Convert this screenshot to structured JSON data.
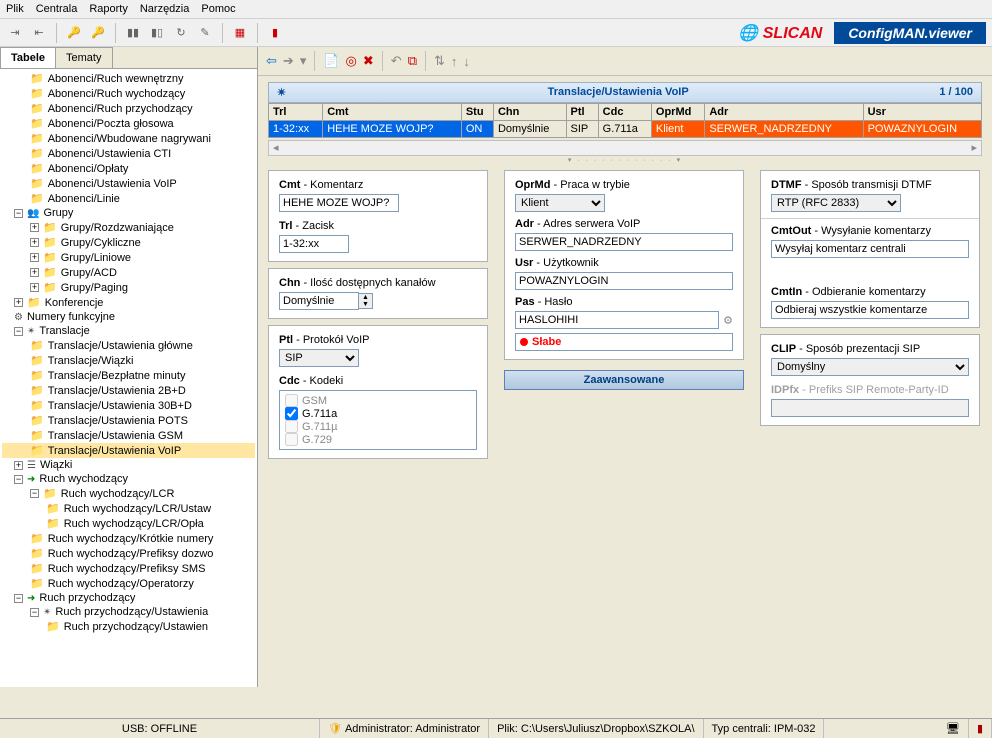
{
  "menu": [
    "Plik",
    "Centrala",
    "Raporty",
    "Narzędzia",
    "Pomoc"
  ],
  "brand": {
    "logo": "SLICAN",
    "title": "ConfigMAN.viewer"
  },
  "tabs": {
    "active": "Tabele",
    "other": "Tematy"
  },
  "tree": [
    {
      "lvl": 1,
      "icon": "f",
      "text": "Abonenci/Ruch wewnętrzny"
    },
    {
      "lvl": 1,
      "icon": "f",
      "text": "Abonenci/Ruch wychodzący"
    },
    {
      "lvl": 1,
      "icon": "f",
      "text": "Abonenci/Ruch przychodzący"
    },
    {
      "lvl": 1,
      "icon": "f",
      "text": "Abonenci/Poczta głosowa"
    },
    {
      "lvl": 1,
      "icon": "f",
      "text": "Abonenci/Wbudowane nagrywani"
    },
    {
      "lvl": 1,
      "icon": "f",
      "text": "Abonenci/Ustawienia CTI"
    },
    {
      "lvl": 1,
      "icon": "f",
      "text": "Abonenci/Opłaty"
    },
    {
      "lvl": 1,
      "icon": "f",
      "text": "Abonenci/Ustawienia VoIP"
    },
    {
      "lvl": 1,
      "icon": "f",
      "text": "Abonenci/Linie"
    },
    {
      "lvl": 0,
      "icon": "bm",
      "text": "Grupy"
    },
    {
      "lvl": 1,
      "icon": "bp",
      "text": "Grupy/Rozdzwaniające"
    },
    {
      "lvl": 1,
      "icon": "bp",
      "text": "Grupy/Cykliczne"
    },
    {
      "lvl": 1,
      "icon": "bp",
      "text": "Grupy/Liniowe"
    },
    {
      "lvl": 1,
      "icon": "bp",
      "text": "Grupy/ACD"
    },
    {
      "lvl": 1,
      "icon": "bp",
      "text": "Grupy/Paging"
    },
    {
      "lvl": 0,
      "icon": "bp",
      "text": "Konferencje"
    },
    {
      "lvl": 0,
      "icon": "m",
      "text": "Numery funkcyjne"
    },
    {
      "lvl": 0,
      "icon": "bm-t",
      "text": "Translacje"
    },
    {
      "lvl": 1,
      "icon": "f",
      "text": "Translacje/Ustawienia główne"
    },
    {
      "lvl": 1,
      "icon": "f",
      "text": "Translacje/Wiązki"
    },
    {
      "lvl": 1,
      "icon": "f",
      "text": "Translacje/Bezpłatne minuty"
    },
    {
      "lvl": 1,
      "icon": "f",
      "text": "Translacje/Ustawienia 2B+D"
    },
    {
      "lvl": 1,
      "icon": "f",
      "text": "Translacje/Ustawienia 30B+D"
    },
    {
      "lvl": 1,
      "icon": "f",
      "text": "Translacje/Ustawienia POTS"
    },
    {
      "lvl": 1,
      "icon": "f",
      "text": "Translacje/Ustawienia GSM"
    },
    {
      "lvl": 1,
      "icon": "f",
      "text": "Translacje/Ustawienia VoIP",
      "sel": true
    },
    {
      "lvl": 0,
      "icon": "bp-w",
      "text": "Wiązki"
    },
    {
      "lvl": 0,
      "icon": "bm-a",
      "text": "Ruch wychodzący"
    },
    {
      "lvl": 1,
      "icon": "bm-f",
      "text": "Ruch wychodzący/LCR"
    },
    {
      "lvl": 2,
      "icon": "f",
      "text": "Ruch wychodzący/LCR/Ustaw"
    },
    {
      "lvl": 2,
      "icon": "f",
      "text": "Ruch wychodzący/LCR/Opła"
    },
    {
      "lvl": 1,
      "icon": "f",
      "text": "Ruch wychodzący/Krótkie numery"
    },
    {
      "lvl": 1,
      "icon": "f",
      "text": "Ruch wychodzący/Prefiksy dozwo"
    },
    {
      "lvl": 1,
      "icon": "f",
      "text": "Ruch wychodzący/Prefiksy SMS"
    },
    {
      "lvl": 1,
      "icon": "f",
      "text": "Ruch wychodzący/Operatorzy"
    },
    {
      "lvl": 0,
      "icon": "bm-a",
      "text": "Ruch przychodzący"
    },
    {
      "lvl": 1,
      "icon": "bm-t",
      "text": "Ruch przychodzący/Ustawienia"
    },
    {
      "lvl": 2,
      "icon": "f",
      "text": "Ruch przychodzący/Ustawien"
    }
  ],
  "grid": {
    "title": "Translacje/Ustawienia VoIP",
    "counter": "1 / 100",
    "headers": [
      "Trl",
      "Cmt",
      "Stu",
      "Chn",
      "Ptl",
      "Cdc",
      "OprMd",
      "Adr",
      "Usr"
    ],
    "row": {
      "Trl": "1-32:xx",
      "Cmt": "HEHE MOZE WOJP?",
      "Stu": "ON",
      "Chn": "Domyślnie",
      "Ptl": "SIP",
      "Cdc": "G.711a",
      "OprMd": "Klient",
      "Adr": "SERWER_NADRZEDNY",
      "Usr": "POWAZNYLOGIN"
    }
  },
  "form": {
    "cmt": {
      "label_b": "Cmt",
      "label": " - Komentarz",
      "value": "HEHE MOZE WOJP?"
    },
    "trl": {
      "label_b": "Trl",
      "label": " - Zacisk",
      "value": "1-32:xx"
    },
    "chn": {
      "label_b": "Chn",
      "label": " - Ilość dostępnych kanałów",
      "value": "Domyślnie"
    },
    "ptl": {
      "label_b": "Ptl",
      "label": " - Protokół VoIP",
      "value": "SIP"
    },
    "cdc": {
      "label_b": "Cdc",
      "label": " - Kodeki",
      "items": [
        "GSM",
        "G.711a",
        "G.711µ",
        "G.729"
      ],
      "checked": 1
    },
    "oprmd": {
      "label_b": "OprMd",
      "label": " - Praca w trybie",
      "value": "Klient"
    },
    "adr": {
      "label_b": "Adr",
      "label": " - Adres serwera VoIP",
      "value": "SERWER_NADRZEDNY"
    },
    "usr": {
      "label_b": "Usr",
      "label": " - Użytkownik",
      "value": "POWAZNYLOGIN"
    },
    "pas": {
      "label_b": "Pas",
      "label": " - Hasło",
      "value": "HASLOHIHI"
    },
    "pas_strength": "Słabe",
    "advanced": "Zaawansowane",
    "dtmf": {
      "label_b": "DTMF",
      "label": " - Sposób transmisji DTMF",
      "value": "RTP (RFC 2833)"
    },
    "cmtout": {
      "label_b": "CmtOut",
      "label": " - Wysyłanie komentarzy",
      "value": "Wysyłaj komentarz centrali"
    },
    "cmtin": {
      "label_b": "CmtIn",
      "label": " - Odbieranie komentarzy",
      "value": "Odbieraj wszystkie komentarze"
    },
    "clip": {
      "label_b": "CLIP",
      "label": " - Sposób prezentacji SIP",
      "value": "Domyślny"
    },
    "idpfx": {
      "label_b": "IDPfx",
      "label": " - Prefiks SIP Remote-Party-ID",
      "value": ""
    }
  },
  "status": {
    "usb": "USB: OFFLINE",
    "admin": "Administrator: Administrator",
    "file": "Plik: C:\\Users\\Juliusz\\Dropbox\\SZKOLA\\",
    "type": "Typ centrali: IPM-032"
  }
}
